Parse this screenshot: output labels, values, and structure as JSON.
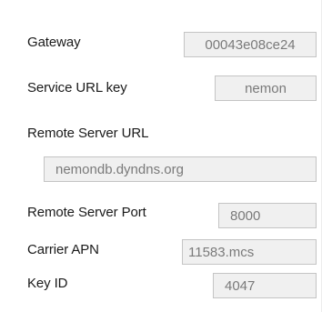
{
  "fields": {
    "gateway": {
      "label": "Gateway",
      "value": "00043e08ce24"
    },
    "service_url_key": {
      "label": "Service URL key",
      "value": "nemon"
    },
    "remote_server_url": {
      "label": "Remote Server URL",
      "value": "nemondb.dyndns.org"
    },
    "remote_server_port": {
      "label": "Remote Server Port",
      "value": "8000"
    },
    "carrier_apn": {
      "label": "Carrier APN",
      "value": "11583.mcs"
    },
    "key_id": {
      "label": "Key ID",
      "value": "4047"
    }
  }
}
